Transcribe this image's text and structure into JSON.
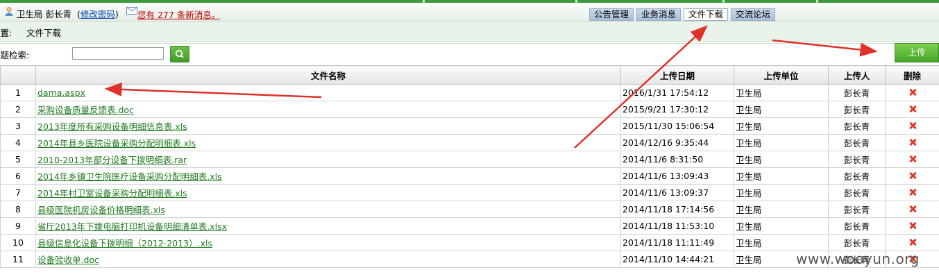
{
  "header": {
    "org": "卫生局",
    "user": "彭长青",
    "change_password": "修改密码",
    "message": "您有 277 条新消息。"
  },
  "tabs": [
    {
      "label": "公告管理"
    },
    {
      "label": "业务消息"
    },
    {
      "label": "文件下载"
    },
    {
      "label": "交流论坛"
    }
  ],
  "breadcrumb": {
    "prefix": "位置:",
    "current": "文件下载"
  },
  "search": {
    "label": "标题检索:",
    "value": ""
  },
  "upload_label": "上传",
  "table": {
    "columns": [
      "",
      "文件名称",
      "上传日期",
      "上传单位",
      "上传人",
      "删除"
    ],
    "rows": [
      {
        "no": "1",
        "name": "dama.aspx",
        "date": "2016/1/31 17:54:12",
        "unit": "卫生局",
        "uploader": "彭长青"
      },
      {
        "no": "2",
        "name": "采购设备质量反馈表.doc",
        "date": "2015/9/21 17:30:12",
        "unit": "卫生局",
        "uploader": "彭长青"
      },
      {
        "no": "3",
        "name": "2013年度所有采购设备明细信息表.xls",
        "date": "2015/11/30 15:06:54",
        "unit": "卫生局",
        "uploader": "彭长青"
      },
      {
        "no": "4",
        "name": "2014年县乡医院设备采购分配明细表.xls",
        "date": "2014/12/16 9:35:44",
        "unit": "卫生局",
        "uploader": "彭长青"
      },
      {
        "no": "5",
        "name": "2010-2013年部分设备下拨明细表.rar",
        "date": "2014/11/6 8:31:50",
        "unit": "卫生局",
        "uploader": "彭长青"
      },
      {
        "no": "6",
        "name": "2014年乡镇卫生院医疗设备采购分配明细表.xls",
        "date": "2014/11/6 13:09:43",
        "unit": "卫生局",
        "uploader": "彭长青"
      },
      {
        "no": "7",
        "name": "2014年村卫室设备采购分配明细表.xls",
        "date": "2014/11/6 13:09:37",
        "unit": "卫生局",
        "uploader": "彭长青"
      },
      {
        "no": "8",
        "name": "县级医院机房设备价格明细表.xls",
        "date": "2014/11/18 17:14:56",
        "unit": "卫生局",
        "uploader": "彭长青"
      },
      {
        "no": "9",
        "name": "省厅2013年下拨电脑打印机设备明细清单表.xlsx",
        "date": "2014/11/18 11:53:10",
        "unit": "卫生局",
        "uploader": "彭长青"
      },
      {
        "no": "10",
        "name": "县级信息化设备下拨明细（2012-2013）.xls",
        "date": "2014/11/18 11:11:49",
        "unit": "卫生局",
        "uploader": "彭长青"
      },
      {
        "no": "11",
        "name": "设备验收单.doc",
        "date": "2014/11/10 14:44:21",
        "unit": "卫生局",
        "uploader": "彭长青"
      }
    ]
  },
  "watermark": "www.wooyun.org",
  "colors": {
    "accent_green": "#3d9a3d",
    "link_green": "#1f7a1f",
    "annotation_red": "#e0302a",
    "delete_red": "#e03a2a"
  },
  "icons": [
    "user-icon",
    "mail-icon",
    "search-icon",
    "delete-icon"
  ]
}
